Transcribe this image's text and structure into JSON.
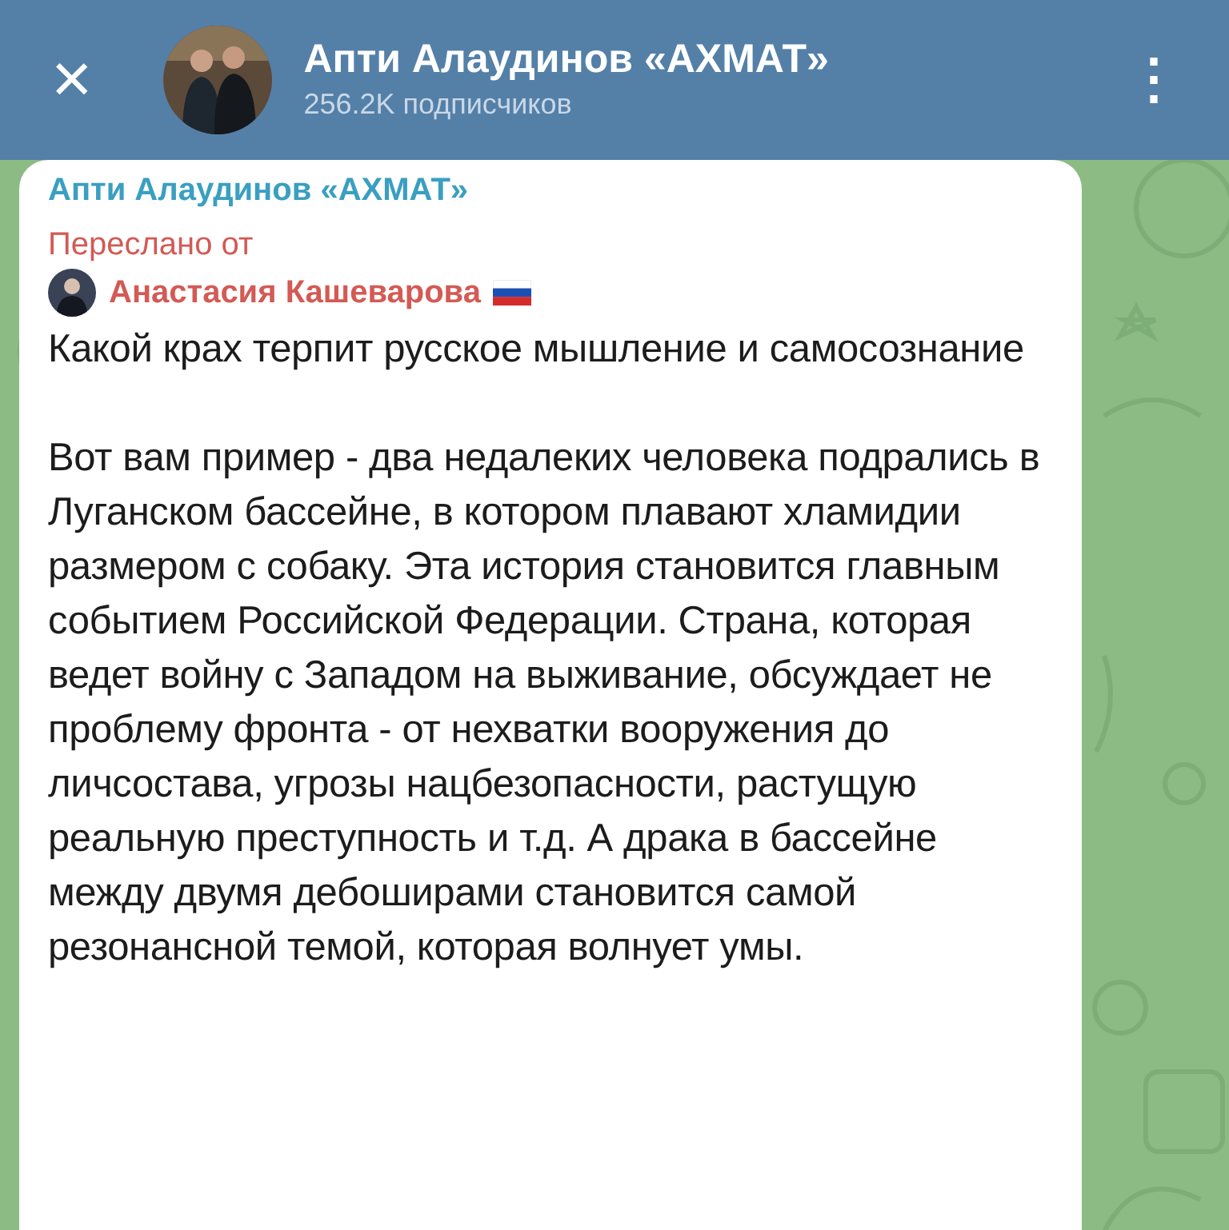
{
  "header": {
    "close": "×",
    "title": "Апти Алаудинов «АХМАТ»",
    "subtitle": "256.2K подписчиков",
    "menu": "⋮"
  },
  "message": {
    "channel": "Апти Алаудинов «АХМАТ»",
    "forwarded_label": "Переслано от",
    "forwarded_from": "Анастасия Кашеварова",
    "paragraphs": [
      "Какой крах терпит русское мышление и самосознание",
      "Вот вам пример - два недалеких человека подрались в Луганском бассейне, в котором плавают хламидии размером с собаку. Эта история становится главным событием Российской Федерации. Страна, которая ведет войну с Западом на выживание, обсуждает не проблему фронта - от нехватки вооружения до личсостава, угрозы нацбезопасности, растущую реальную преступность и т.д. А драка в бассейне между двумя дебоширами становится самой резонансной темой, которая волнует умы."
    ]
  }
}
